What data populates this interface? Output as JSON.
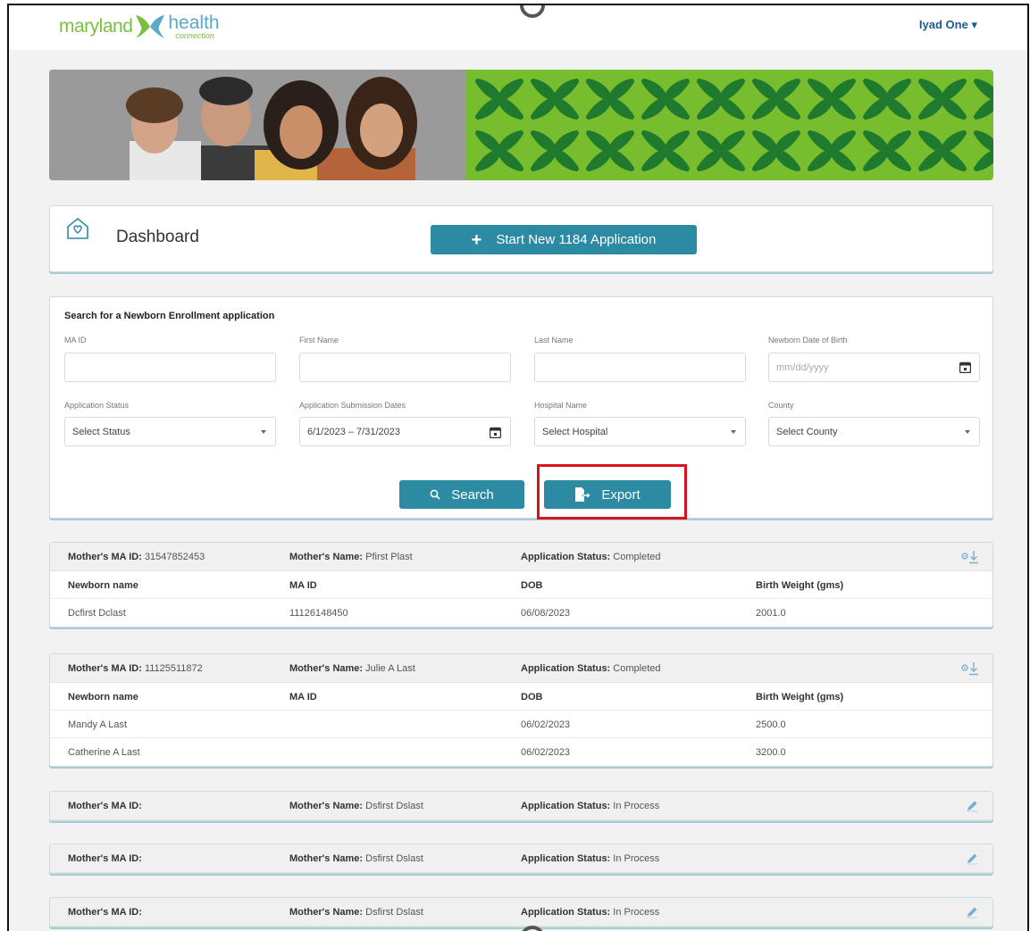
{
  "header": {
    "logo": {
      "word1": "maryland",
      "word2": "health",
      "word3": "connection"
    },
    "user_menu": "Iyad One"
  },
  "dashboard": {
    "title": "Dashboard",
    "start_button": "Start New 1184 Application"
  },
  "search": {
    "title": "Search for a Newborn Enrollment application",
    "fields": {
      "ma_id": {
        "label": "MA ID",
        "value": ""
      },
      "first_name": {
        "label": "First Name",
        "value": ""
      },
      "last_name": {
        "label": "Last Name",
        "value": ""
      },
      "newborn_dob": {
        "label": "Newborn Date of Birth",
        "placeholder": "mm/dd/yyyy"
      },
      "application_status": {
        "label": "Application Status",
        "value": "Select Status"
      },
      "submission_dates": {
        "label": "Application Submission Dates",
        "value": "6/1/2023 – 7/31/2023"
      },
      "hospital_name": {
        "label": "Hospital Name",
        "value": "Select Hospital"
      },
      "county": {
        "label": "County",
        "value": "Select County"
      }
    },
    "search_button": "Search",
    "export_button": "Export"
  },
  "results": {
    "labels": {
      "mother_ma_id": "Mother's MA ID:",
      "mother_name": "Mother's Name:",
      "application_status": "Application Status:"
    },
    "columns": [
      "Newborn name",
      "MA ID",
      "DOB",
      "Birth Weight (gms)"
    ],
    "cards": [
      {
        "mother_ma_id": "31547852453",
        "mother_name": "Pfirst Plast",
        "status": "Completed",
        "rows": [
          [
            "Dcfirst Dclast",
            "11126148450",
            "06/08/2023",
            "2001.0"
          ]
        ]
      },
      {
        "mother_ma_id": "11125511872",
        "mother_name": "Julie A Last",
        "status": "Completed",
        "rows": [
          [
            "Mandy A Last",
            "",
            "06/02/2023",
            "2500.0"
          ],
          [
            "Catherine A Last",
            "",
            "06/02/2023",
            "3200.0"
          ]
        ]
      },
      {
        "mother_ma_id": "",
        "mother_name": "Dsfirst Dslast",
        "status": "In Process"
      },
      {
        "mother_ma_id": "",
        "mother_name": "Dsfirst Dslast",
        "status": "In Process"
      },
      {
        "mother_ma_id": "",
        "mother_name": "Dsfirst Dslast",
        "status": "In Process"
      }
    ]
  },
  "colors": {
    "primary_button": "#2c8aa3",
    "brand_green": "#78bd2e",
    "brand_blue": "#5aa9c8",
    "highlight_red": "#d9141c"
  }
}
